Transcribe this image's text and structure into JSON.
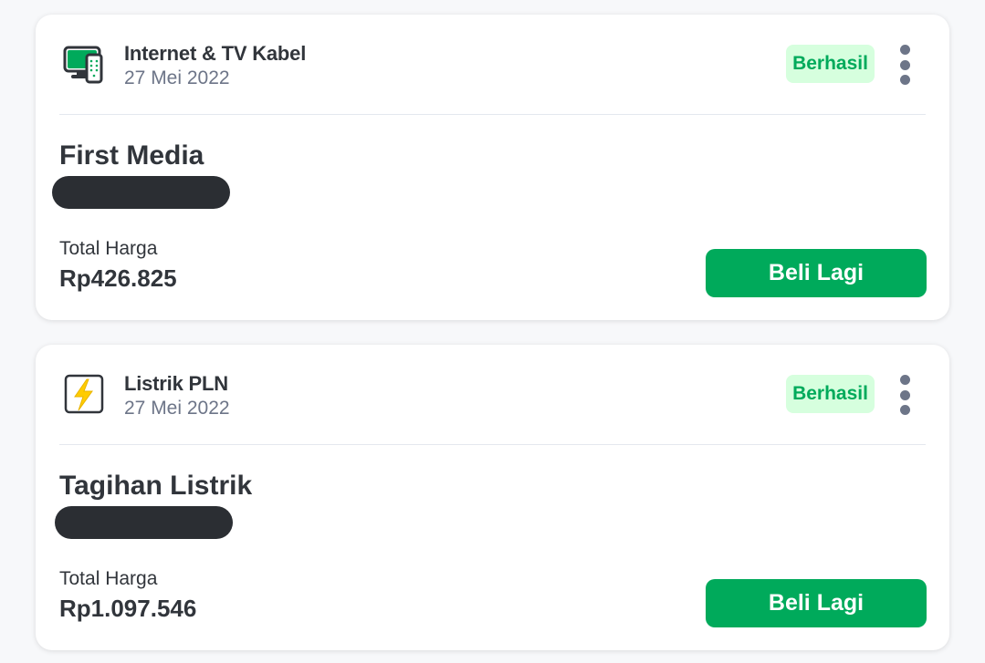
{
  "transactions": [
    {
      "category": "Internet & TV Kabel",
      "date": "27 Mei 2022",
      "status": "Berhasil",
      "product": "First Media",
      "total_label": "Total Harga",
      "total_value": "Rp426.825",
      "button_label": "Beli Lagi",
      "icon": "tv-remote-icon"
    },
    {
      "category": "Listrik PLN",
      "date": "27 Mei 2022",
      "status": "Berhasil",
      "product": "Tagihan Listrik",
      "total_label": "Total Harga",
      "total_value": "Rp1.097.546",
      "button_label": "Beli Lagi",
      "icon": "lightning-bolt-icon"
    }
  ],
  "colors": {
    "accent": "#00aa5b",
    "status_bg": "#d6ffde",
    "text": "#31353b",
    "muted": "#6d7588",
    "redaction": "#2b2e33"
  }
}
